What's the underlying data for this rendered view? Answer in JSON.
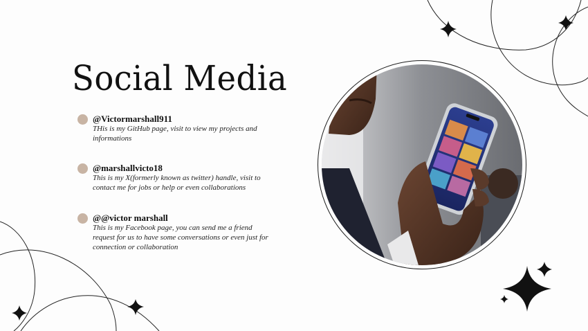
{
  "slide": {
    "title": "Social Media",
    "accent_color": "#c8b4a4",
    "entries": [
      {
        "handle": "@Victormarshall911",
        "description": "THis is my GitHub page, visit to view my projects and informations"
      },
      {
        "handle": "@marshallvicto18",
        "description": "This is my X(formerly known as twitter) handle, visit to contact me for jobs or help or even collaborations"
      },
      {
        "handle": "@@victor marshall",
        "description": "This is my Facebook page, you can send me a friend request for us to have some conversations or even just for connection or collaboration"
      }
    ]
  },
  "photo": {
    "subject": "person-holding-smartphone-with-social-media-app"
  }
}
